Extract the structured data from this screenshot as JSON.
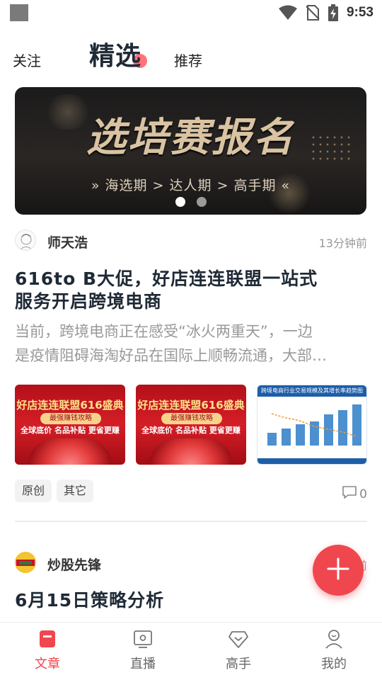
{
  "status_bar": {
    "time": "9:53"
  },
  "top_tabs": [
    {
      "label": "关注"
    },
    {
      "label": "精选"
    },
    {
      "label": "推荐"
    }
  ],
  "banner": {
    "title": "选培赛报名",
    "subtitle": "海选期 > 达人期 > 高手期",
    "left_marker": "»",
    "right_marker": "«",
    "slide_count": 2,
    "active_slide": 0
  },
  "articles": [
    {
      "author": "师天浩",
      "time": "13分钟前",
      "title_lines": [
        "616to B大促，好店连连联盟一站式",
        "服务开启跨境电商"
      ],
      "summary_lines": [
        "当前，跨境电商正在感受“冰火两重天”，一边",
        "是疫情阻碍海淘好品在国际上顺畅流通，大部…"
      ],
      "thumbnails": [
        {
          "head": "好店连连联盟616盛典",
          "pill": "最强赚钱攻略",
          "tags": "全球底价  名品补贴  更省更赚"
        },
        {
          "head": "好店连连联盟616盛典",
          "pill": "最强赚钱攻略",
          "tags": "全球底价  名品补贴  更省更赚"
        },
        {
          "head": "跨境电商行业交易规模及其增长率趋势图"
        }
      ],
      "tags": [
        "原创",
        "其它"
      ],
      "comment_count": "0"
    },
    {
      "author": "炒股先锋",
      "time": "前",
      "title": "6月15日策略分析"
    }
  ],
  "bottom_nav": [
    {
      "label": "文章",
      "icon": "article-icon",
      "active": true
    },
    {
      "label": "直播",
      "icon": "live-tv-icon",
      "active": false
    },
    {
      "label": "高手",
      "icon": "diamond-icon",
      "active": false
    },
    {
      "label": "我的",
      "icon": "profile-icon",
      "active": false
    }
  ],
  "colors": {
    "accent": "#f0474f",
    "title_text": "#1f2a36",
    "muted_text": "#999999"
  }
}
